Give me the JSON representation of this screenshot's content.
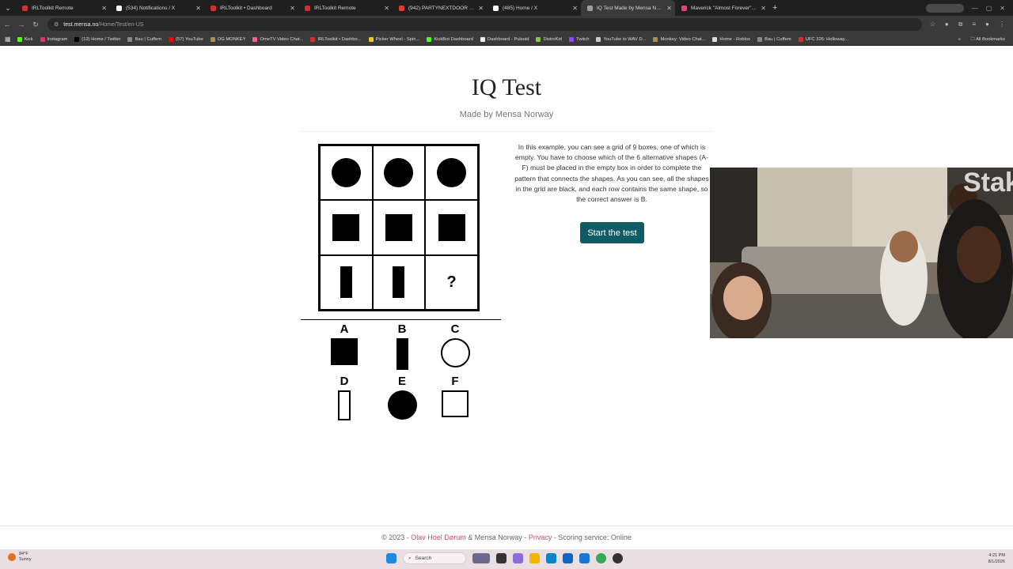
{
  "browser": {
    "tabs": [
      {
        "title": "IRLToolkit Remote",
        "color": "#d32f2f",
        "active": false
      },
      {
        "title": "(534) Notifications / X",
        "color": "#ffffff",
        "active": false
      },
      {
        "title": "IRLToolkit • Dashboard",
        "color": "#d32f2f",
        "active": false
      },
      {
        "title": "IRLToolkit Remote",
        "color": "#d32f2f",
        "active": false
      },
      {
        "title": "(942) PARTYNEXTDOOR - Only",
        "color": "#e53935",
        "active": false
      },
      {
        "title": "(485) Home / X",
        "color": "#ffffff",
        "active": false
      },
      {
        "title": "IQ Test Made by Mensa Norw",
        "color": "#9e9e9e",
        "active": true
      },
      {
        "title": "Maverick \"Almost Forever\" EP",
        "color": "#ec407a",
        "active": false
      }
    ],
    "new_tab": "+",
    "url_host": "test.mensa.no",
    "url_path": "/Home/Test/en-US",
    "bookmarks": [
      {
        "label": "Kick",
        "color": "#53fc18"
      },
      {
        "label": "Instagram",
        "color": "#e1306c"
      },
      {
        "label": "(12) Home / Twitter",
        "color": "#000000"
      },
      {
        "label": "Bau | Cuffem",
        "color": "#888888"
      },
      {
        "label": "(57) YouTube",
        "color": "#ff0000"
      },
      {
        "label": "OG MONKEY",
        "color": "#b0885a"
      },
      {
        "label": "OmeTV Video Chat...",
        "color": "#f06292"
      },
      {
        "label": "IRLToolkit • Dashbo...",
        "color": "#d32f2f"
      },
      {
        "label": "Picker Wheel - Spin...",
        "color": "#fbc02d"
      },
      {
        "label": "KickBot Dashboard",
        "color": "#53fc18"
      },
      {
        "label": "Dashboard - Pulsoid",
        "color": "#eeeeee"
      },
      {
        "label": "DistroKid",
        "color": "#8bc34a"
      },
      {
        "label": "Twitch",
        "color": "#9146ff"
      },
      {
        "label": "YouTube to WAV D...",
        "color": "#cccccc"
      },
      {
        "label": "Monkey: Video Chat...",
        "color": "#b0885a"
      },
      {
        "label": "Home - Roblox",
        "color": "#dddddd"
      },
      {
        "label": "Bau | Cuffem",
        "color": "#888888"
      },
      {
        "label": "UFC 326: Holloway...",
        "color": "#d32f2f"
      }
    ],
    "bookmarks_overflow": "»",
    "all_bookmarks": "All Bookmarks"
  },
  "page": {
    "title": "IQ Test",
    "subtitle": "Made by Mensa Norway",
    "question_mark": "?",
    "options": [
      {
        "letter": "A",
        "shape": "filled-square"
      },
      {
        "letter": "B",
        "shape": "filled-bar"
      },
      {
        "letter": "C",
        "shape": "outline-circle"
      },
      {
        "letter": "D",
        "shape": "outline-bar"
      },
      {
        "letter": "E",
        "shape": "filled-circle"
      },
      {
        "letter": "F",
        "shape": "outline-square"
      }
    ],
    "description": "In this example, you can see a grid of 9 boxes, one of which is empty. You have to choose which of the 6 alternative shapes (A-F) must be placed in the empty box in order to complete the pattern that connects the shapes. As you can see, all the shapes in the grid are black, and each row contains the same shape, so the correct answer is B.",
    "start_button": "Start the test",
    "button_color": "#0e5d66"
  },
  "footer": {
    "prefix": "© 2023 -",
    "author": "Olav Hoel Dørum",
    "org": "& Mensa Norway -",
    "privacy": "Privacy",
    "scoring": "- Scoring service: Online"
  },
  "taskbar": {
    "temp": "84°F",
    "weather": "Sunny",
    "search_placeholder": "Search",
    "time": "4:21 PM",
    "date": "8/1/2026"
  }
}
